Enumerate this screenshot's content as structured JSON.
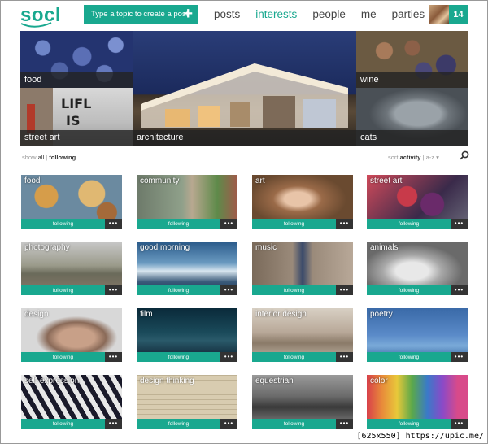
{
  "header": {
    "logo": "socl",
    "create_button": "Type a topic to create a post",
    "create_plus": "+",
    "nav": [
      "posts",
      "interests",
      "people",
      "me",
      "parties"
    ],
    "active_nav": "interests",
    "badge_count": "14"
  },
  "colors": {
    "accent": "#19a88f",
    "bar_dark": "#333333"
  },
  "hero": [
    {
      "label": "food"
    },
    {
      "label": "architecture"
    },
    {
      "label": "wine"
    },
    {
      "label": "street art"
    },
    {
      "label": "cats"
    }
  ],
  "filters": {
    "show_label": "show",
    "show_all": "all",
    "show_following": "following",
    "sort_label": "sort",
    "sort_activity": "activity",
    "sort_az": "a-z",
    "separator": "|",
    "caret": "▾"
  },
  "tiles": [
    {
      "title": "food",
      "follow": "following",
      "more": "•••"
    },
    {
      "title": "community",
      "follow": "following",
      "more": "•••"
    },
    {
      "title": "art",
      "follow": "following",
      "more": "•••"
    },
    {
      "title": "street art",
      "follow": "following",
      "more": "•••"
    },
    {
      "title": "photography",
      "follow": "following",
      "more": "•••"
    },
    {
      "title": "good morning",
      "follow": "following",
      "more": "•••"
    },
    {
      "title": "music",
      "follow": "following",
      "more": "•••"
    },
    {
      "title": "animals",
      "follow": "following",
      "more": "•••"
    },
    {
      "title": "design",
      "follow": "following",
      "more": "•••"
    },
    {
      "title": "film",
      "follow": "following",
      "more": "•••"
    },
    {
      "title": "interior design",
      "follow": "following",
      "more": "•••"
    },
    {
      "title": "poetry",
      "follow": "following",
      "more": "•••"
    },
    {
      "title": "self-expression",
      "follow": "following",
      "more": "•••"
    },
    {
      "title": "design thinking",
      "follow": "following",
      "more": "•••"
    },
    {
      "title": "equestrian",
      "follow": "following",
      "more": "•••"
    },
    {
      "title": "color",
      "follow": "following",
      "more": "•••"
    }
  ],
  "watermark": "[625x550] https://upic.me/"
}
